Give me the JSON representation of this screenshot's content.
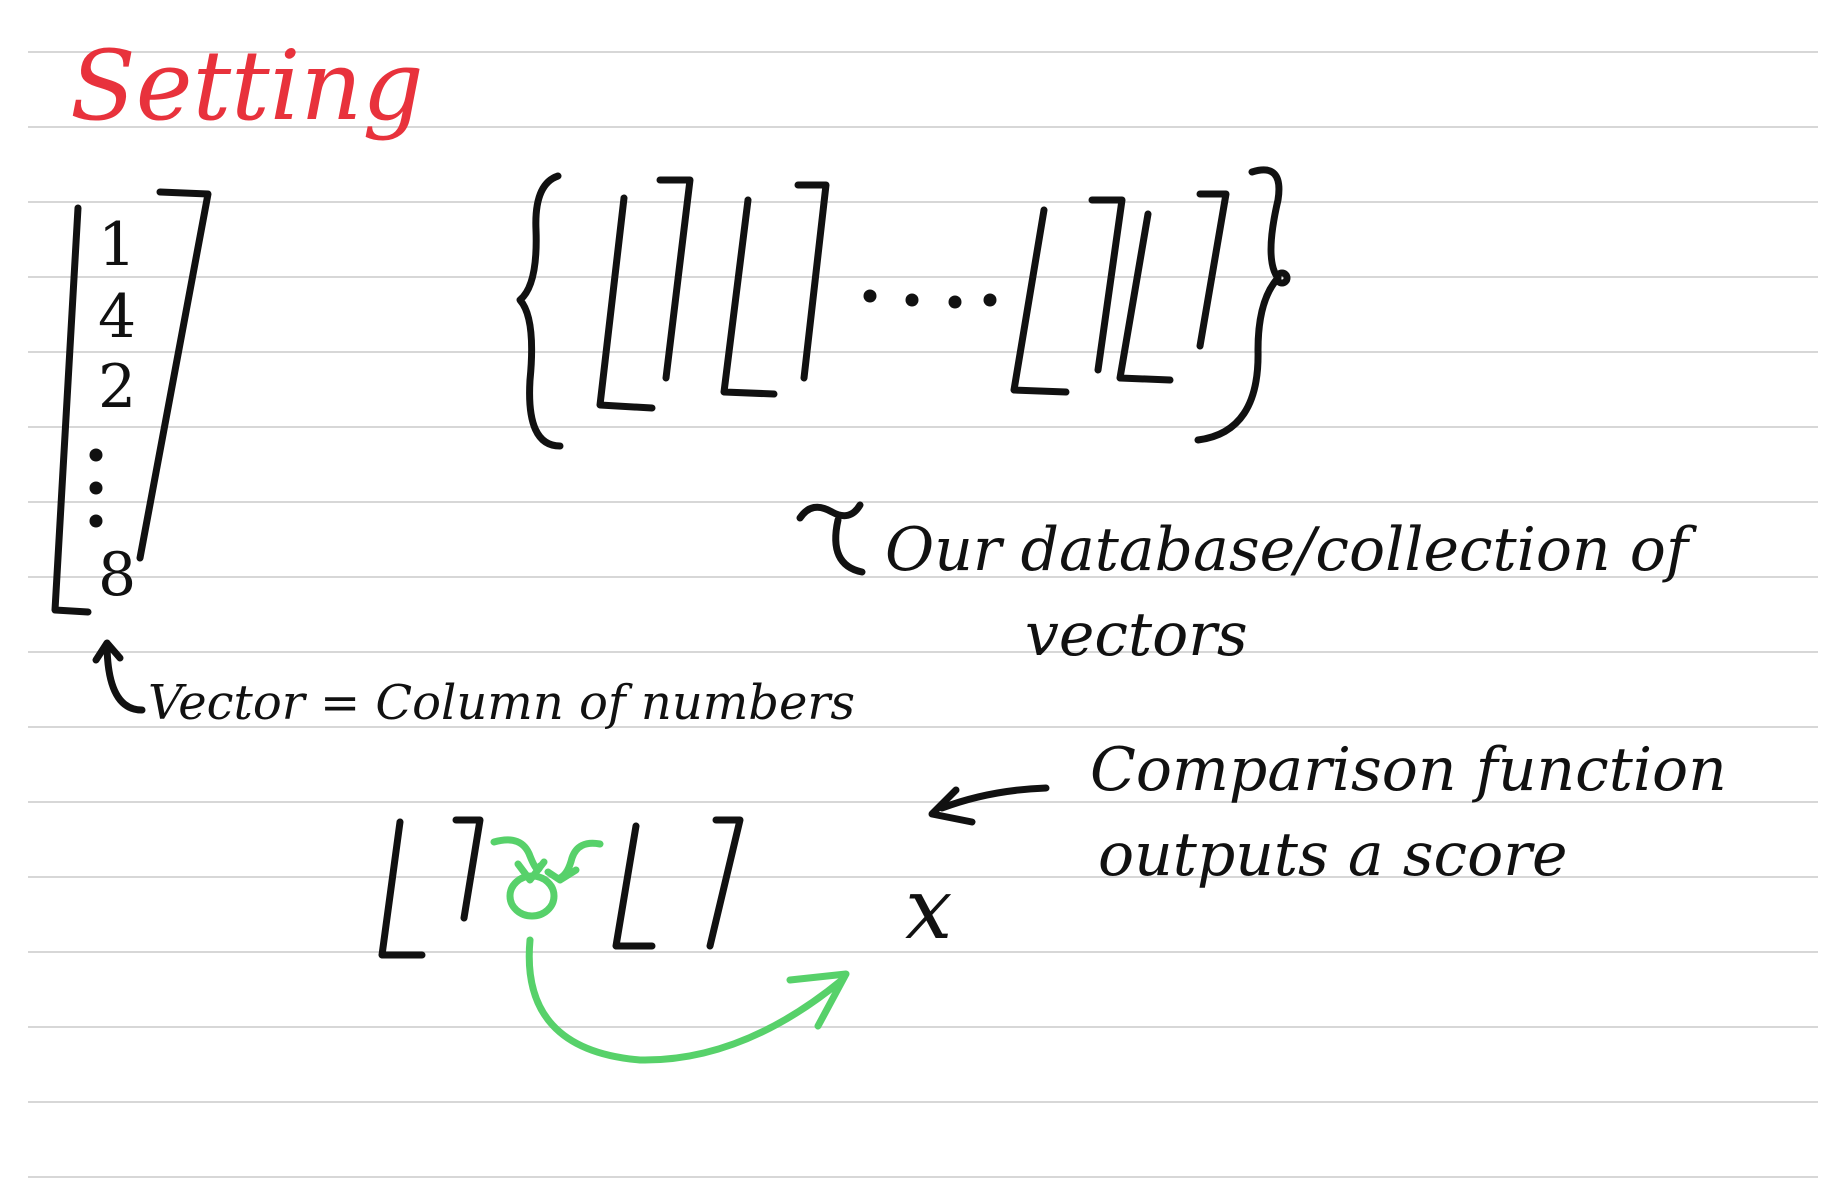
{
  "title": "Setting",
  "vector": {
    "entries": [
      "1",
      "4",
      "2",
      "8"
    ],
    "annotation": "Vector = Column of numbers"
  },
  "database": {
    "annotation_line1": "Our database/collection of",
    "annotation_line2": "vectors"
  },
  "comparison": {
    "annotation_line1": "Comparison function",
    "annotation_line2": "outputs a score",
    "result_symbol": "x"
  },
  "colors": {
    "ink": "#111111",
    "title": "#e8323c",
    "green": "#57d16a",
    "rule": "#d7d7d7"
  }
}
